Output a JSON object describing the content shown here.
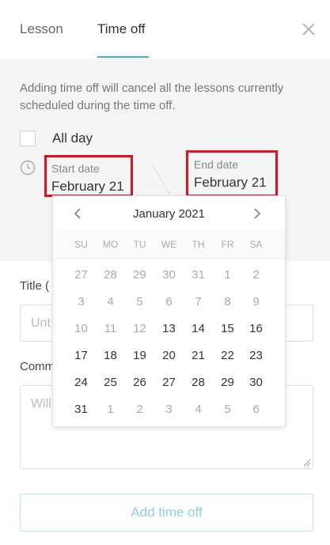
{
  "tabs": [
    {
      "label": "Lesson"
    },
    {
      "label": "Time off"
    }
  ],
  "notice": "Adding time off will cancel all the lessons currently scheduled during the time off.",
  "all_day_label": "All day",
  "start": {
    "label": "Start date",
    "value": "February 21"
  },
  "end": {
    "label": "End date",
    "value": "February 21"
  },
  "title_field": {
    "label": "Title (",
    "placeholder": "Unt"
  },
  "comment_field": {
    "label": "Comm",
    "placeholder": "Will"
  },
  "add_button": "Add time off",
  "calendar": {
    "month": "January 2021",
    "weekdays": [
      "SU",
      "MO",
      "TU",
      "WE",
      "TH",
      "FR",
      "SA"
    ],
    "weeks": [
      [
        {
          "d": "27",
          "m": true
        },
        {
          "d": "28",
          "m": true
        },
        {
          "d": "29",
          "m": true
        },
        {
          "d": "30",
          "m": true
        },
        {
          "d": "31",
          "m": true
        },
        {
          "d": "1",
          "m": true
        },
        {
          "d": "2",
          "m": true
        }
      ],
      [
        {
          "d": "3",
          "m": true
        },
        {
          "d": "4",
          "m": true
        },
        {
          "d": "5",
          "m": true
        },
        {
          "d": "6",
          "m": true
        },
        {
          "d": "7",
          "m": true
        },
        {
          "d": "8",
          "m": true
        },
        {
          "d": "9",
          "m": true
        }
      ],
      [
        {
          "d": "10",
          "m": true
        },
        {
          "d": "11",
          "m": true
        },
        {
          "d": "12",
          "m": true
        },
        {
          "d": "13",
          "m": false
        },
        {
          "d": "14",
          "m": false
        },
        {
          "d": "15",
          "m": false
        },
        {
          "d": "16",
          "m": false
        }
      ],
      [
        {
          "d": "17",
          "m": false
        },
        {
          "d": "18",
          "m": false
        },
        {
          "d": "19",
          "m": false
        },
        {
          "d": "20",
          "m": false
        },
        {
          "d": "21",
          "m": false
        },
        {
          "d": "22",
          "m": false
        },
        {
          "d": "23",
          "m": false
        }
      ],
      [
        {
          "d": "24",
          "m": false
        },
        {
          "d": "25",
          "m": false
        },
        {
          "d": "26",
          "m": false
        },
        {
          "d": "27",
          "m": false
        },
        {
          "d": "28",
          "m": false
        },
        {
          "d": "29",
          "m": false
        },
        {
          "d": "30",
          "m": false
        }
      ],
      [
        {
          "d": "31",
          "m": false
        },
        {
          "d": "1",
          "m": true
        },
        {
          "d": "2",
          "m": true
        },
        {
          "d": "3",
          "m": true
        },
        {
          "d": "4",
          "m": true
        },
        {
          "d": "5",
          "m": true
        },
        {
          "d": "6",
          "m": true
        }
      ]
    ]
  },
  "colors": {
    "accent": "#3ab7bf",
    "highlight_box": "#e0101c"
  },
  "icons": [
    "close-icon",
    "clock-icon",
    "chevron-left-icon",
    "chevron-right-icon",
    "resize-handle-icon"
  ]
}
